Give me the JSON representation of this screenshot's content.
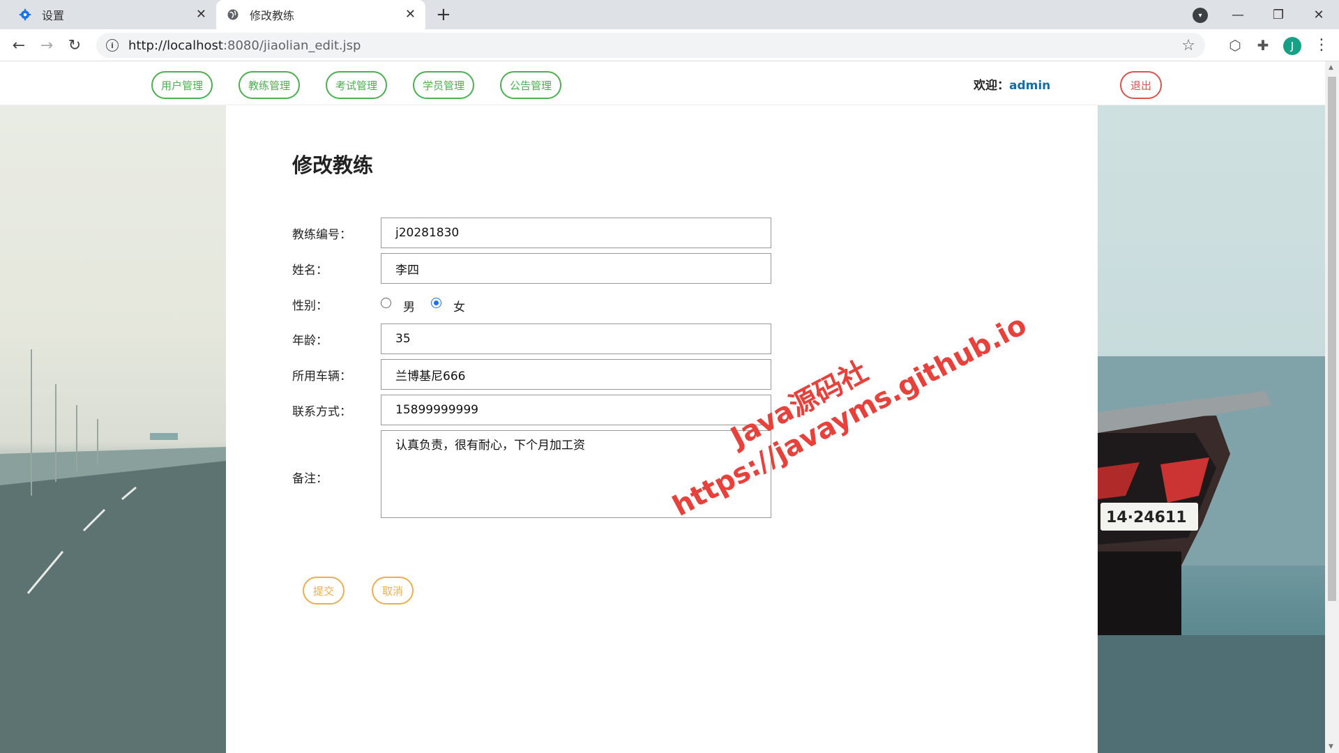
{
  "browser": {
    "tabs": [
      {
        "title": "设置",
        "icon": "gear-icon",
        "active": false
      },
      {
        "title": "修改教练",
        "icon": "globe-icon",
        "active": true
      }
    ],
    "url_host": "http://localhost",
    "url_rest": ":8080/jiaolian_edit.jsp",
    "profile_initial": "J"
  },
  "nav": {
    "items": [
      "用户管理",
      "教练管理",
      "考试管理",
      "学员管理",
      "公告管理"
    ],
    "welcome_label": "欢迎：",
    "username": "admin",
    "logout": "退出"
  },
  "form": {
    "title": "修改教练",
    "coach_id_label": "教练编号：",
    "coach_id_value": "j20281830",
    "name_label": "姓名：",
    "name_value": "李四",
    "gender_label": "性别：",
    "gender_options": [
      "男",
      "女"
    ],
    "gender_selected": "女",
    "age_label": "年龄：",
    "age_value": "35",
    "vehicle_label": "所用车辆：",
    "vehicle_value": "兰博基尼666",
    "contact_label": "联系方式：",
    "contact_value": "15899999999",
    "remark_label": "备注：",
    "remark_value": "认真负责，很有耐心，下个月加工资",
    "submit": "提交",
    "cancel": "取消"
  },
  "watermark": {
    "line1": "Java源码社",
    "line2": "https://javayms.github.io"
  },
  "colors": {
    "nav_green": "#4caf50",
    "logout_red": "#d9534f",
    "action_orange": "#f0ad4e",
    "watermark_red": "#e8403a",
    "radio_blue": "#1a73e8"
  }
}
